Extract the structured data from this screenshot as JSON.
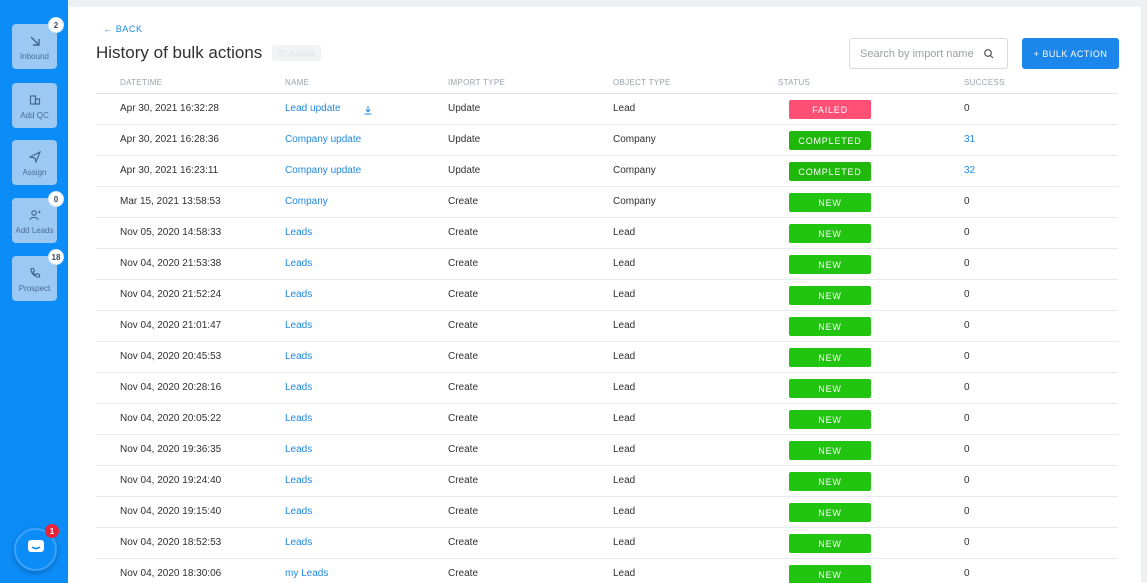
{
  "colors": {
    "sidebar": "#0c8cf7",
    "accent": "#1c86ea",
    "failed": "#ff4f75",
    "completed": "#21b80c",
    "new": "#21c40f"
  },
  "sidebar": {
    "items": [
      {
        "label": "Inbound",
        "icon": "arrow-down-right-icon",
        "badge": "2"
      },
      {
        "label": "Add QC",
        "icon": "building-icon",
        "badge": ""
      },
      {
        "label": "Assign",
        "icon": "send-icon",
        "badge": ""
      },
      {
        "label": "Add Leads",
        "icon": "add-user-icon",
        "badge": "0"
      },
      {
        "label": "Prospect",
        "icon": "phone-icon",
        "badge": "18"
      }
    ],
    "chat_badge": "1"
  },
  "header": {
    "back_label": "← BACK",
    "title": "History of bulk actions",
    "count_chip": "20 Actions",
    "search_placeholder": "Search by import name",
    "bulk_action_label": "+ BULK ACTION"
  },
  "table": {
    "columns": [
      "DATETIME",
      "NAME",
      "IMPORT TYPE",
      "OBJECT TYPE",
      "STATUS",
      "SUCCESS"
    ],
    "rows": [
      {
        "datetime": "Apr 30, 2021 16:32:28",
        "name": "Lead update",
        "import_type": "Update",
        "object_type": "Lead",
        "status": "FAILED",
        "success": "0",
        "download": true
      },
      {
        "datetime": "Apr 30, 2021 16:28:36",
        "name": "Company update",
        "import_type": "Update",
        "object_type": "Company",
        "status": "COMPLETED",
        "success": "31"
      },
      {
        "datetime": "Apr 30, 2021 16:23:11",
        "name": "Company update",
        "import_type": "Update",
        "object_type": "Company",
        "status": "COMPLETED",
        "success": "32"
      },
      {
        "datetime": "Mar 15, 2021 13:58:53",
        "name": "Company",
        "import_type": "Create",
        "object_type": "Company",
        "status": "NEW",
        "success": "0"
      },
      {
        "datetime": "Nov 05, 2020 14:58:33",
        "name": "Leads",
        "import_type": "Create",
        "object_type": "Lead",
        "status": "NEW",
        "success": "0"
      },
      {
        "datetime": "Nov 04, 2020 21:53:38",
        "name": "Leads",
        "import_type": "Create",
        "object_type": "Lead",
        "status": "NEW",
        "success": "0"
      },
      {
        "datetime": "Nov 04, 2020 21:52:24",
        "name": "Leads",
        "import_type": "Create",
        "object_type": "Lead",
        "status": "NEW",
        "success": "0"
      },
      {
        "datetime": "Nov 04, 2020 21:01:47",
        "name": "Leads",
        "import_type": "Create",
        "object_type": "Lead",
        "status": "NEW",
        "success": "0"
      },
      {
        "datetime": "Nov 04, 2020 20:45:53",
        "name": "Leads",
        "import_type": "Create",
        "object_type": "Lead",
        "status": "NEW",
        "success": "0"
      },
      {
        "datetime": "Nov 04, 2020 20:28:16",
        "name": "Leads",
        "import_type": "Create",
        "object_type": "Lead",
        "status": "NEW",
        "success": "0"
      },
      {
        "datetime": "Nov 04, 2020 20:05:22",
        "name": "Leads",
        "import_type": "Create",
        "object_type": "Lead",
        "status": "NEW",
        "success": "0"
      },
      {
        "datetime": "Nov 04, 2020 19:36:35",
        "name": "Leads",
        "import_type": "Create",
        "object_type": "Lead",
        "status": "NEW",
        "success": "0"
      },
      {
        "datetime": "Nov 04, 2020 19:24:40",
        "name": "Leads",
        "import_type": "Create",
        "object_type": "Lead",
        "status": "NEW",
        "success": "0"
      },
      {
        "datetime": "Nov 04, 2020 19:15:40",
        "name": "Leads",
        "import_type": "Create",
        "object_type": "Lead",
        "status": "NEW",
        "success": "0"
      },
      {
        "datetime": "Nov 04, 2020 18:52:53",
        "name": "Leads",
        "import_type": "Create",
        "object_type": "Lead",
        "status": "NEW",
        "success": "0"
      },
      {
        "datetime": "Nov 04, 2020 18:30:06",
        "name": "my Leads",
        "import_type": "Create",
        "object_type": "Lead",
        "status": "NEW",
        "success": "0"
      }
    ]
  }
}
